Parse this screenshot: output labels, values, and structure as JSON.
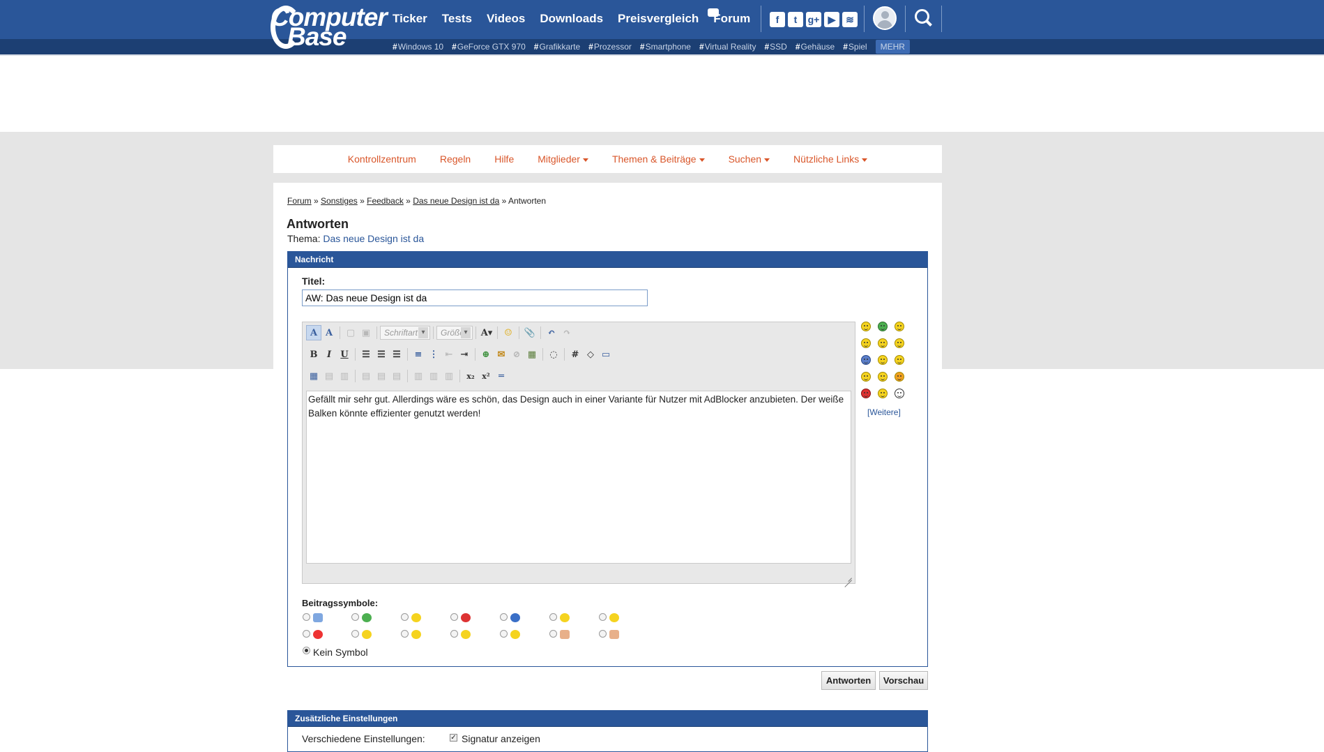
{
  "header": {
    "logo_line1": "Computer",
    "logo_line2": "Base",
    "nav": [
      "Ticker",
      "Tests",
      "Videos",
      "Downloads",
      "Preisvergleich",
      "Forum"
    ],
    "social_icons": [
      "facebook-icon",
      "twitter-icon",
      "google-plus-icon",
      "youtube-icon",
      "rss-icon"
    ],
    "social_glyphs": [
      "f",
      "t",
      "g+",
      "▶",
      "≋"
    ],
    "tags": [
      "Windows 10",
      "GeForce GTX 970",
      "Grafikkarte",
      "Prozessor",
      "Smartphone",
      "Virtual Reality",
      "SSD",
      "Gehäuse",
      "Spiel"
    ],
    "tag_hash": "#",
    "more": "MEHR"
  },
  "subnav": {
    "items": [
      {
        "label": "Kontrollzentrum",
        "dropdown": false
      },
      {
        "label": "Regeln",
        "dropdown": false
      },
      {
        "label": "Hilfe",
        "dropdown": false
      },
      {
        "label": "Mitglieder",
        "dropdown": true
      },
      {
        "label": "Themen & Beiträge",
        "dropdown": true
      },
      {
        "label": "Suchen",
        "dropdown": true
      },
      {
        "label": "Nützliche Links",
        "dropdown": true
      }
    ]
  },
  "breadcrumb": {
    "items": [
      "Forum",
      "Sonstiges",
      "Feedback",
      "Das neue Design ist da"
    ],
    "separator": "»",
    "current": "Antworten"
  },
  "page": {
    "title": "Antworten",
    "topic_label": "Thema:",
    "topic_link": "Das neue Design ist da"
  },
  "message_panel": {
    "header": "Nachricht",
    "title_label": "Titel:",
    "title_value": "AW: Das neue Design ist da",
    "font_select": "Schriftart",
    "size_select": "Größe",
    "body": "Gefällt mir sehr gut. Allerdings wäre es schön, das Design auch in einer Variante für Nutzer mit AdBlocker anzubieten. Der weiße Balken könnte effizienter genutzt werden!",
    "more_smilies": "[Weitere]",
    "post_icons_label": "Beitragssymbole:",
    "no_icon_label": "Kein Symbol"
  },
  "buttons": {
    "submit": "Antworten",
    "preview": "Vorschau"
  },
  "settings_panel": {
    "header": "Zusätzliche Einstellungen",
    "row_label": "Verschiedene Einstellungen:",
    "signature_label": "Signatur anzeigen"
  },
  "colors": {
    "brand_blue": "#2a5699",
    "nav_accent": "#d9562a",
    "page_gray": "#e5e5e5"
  }
}
